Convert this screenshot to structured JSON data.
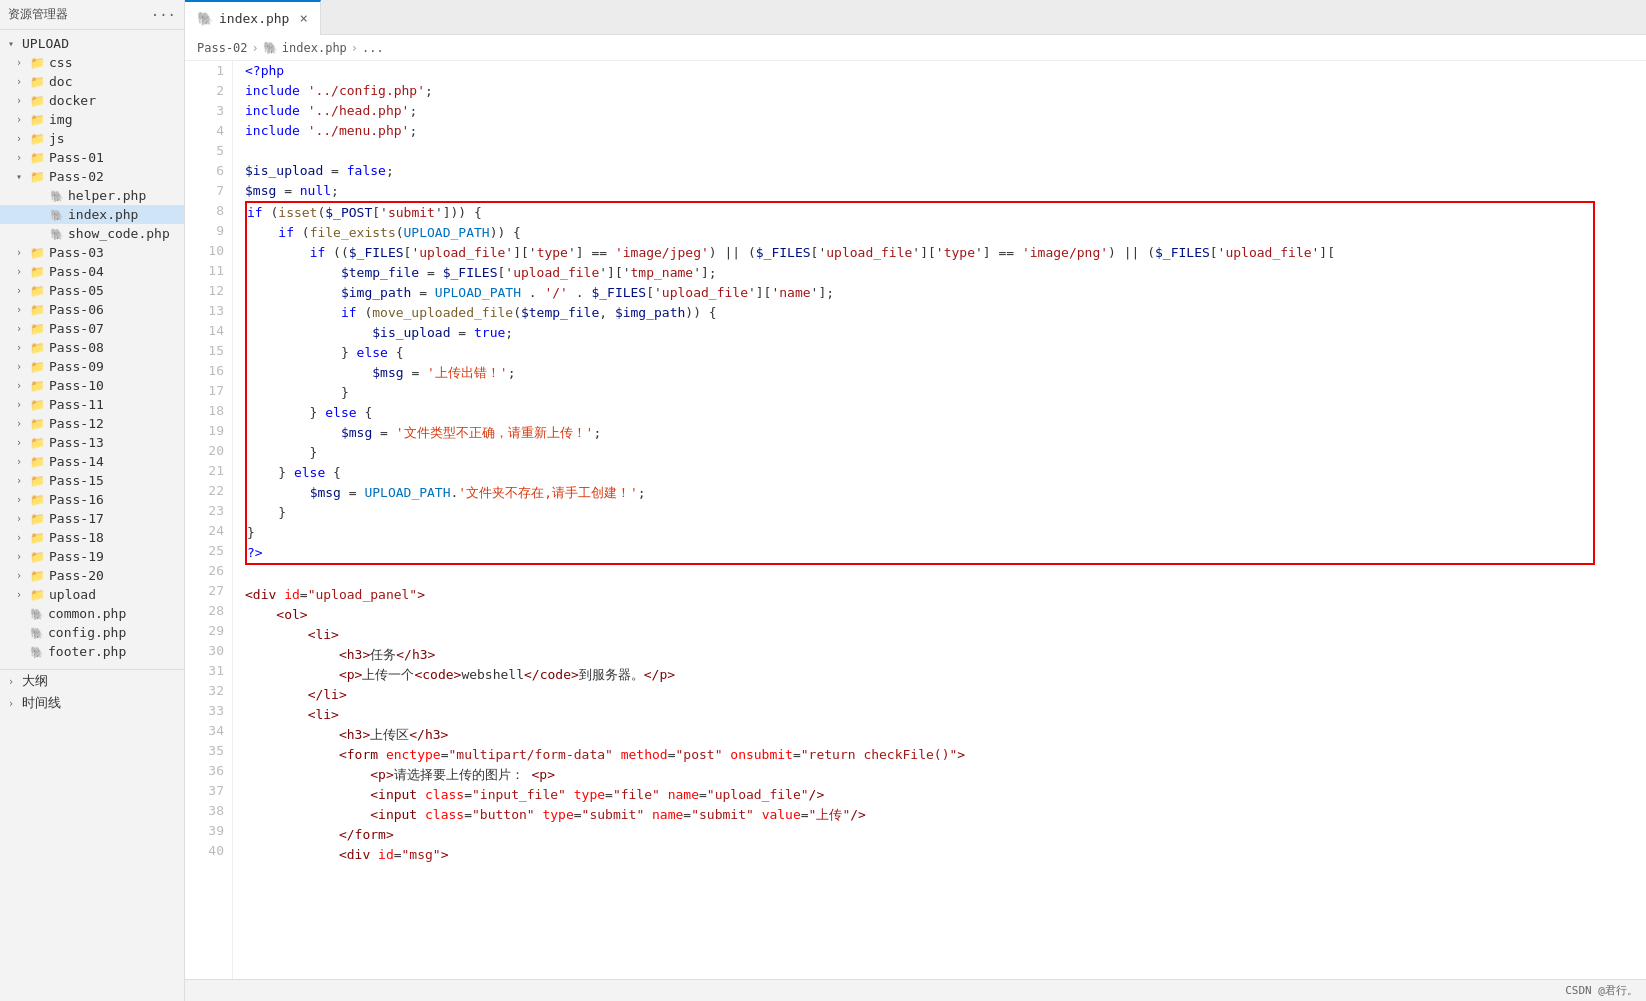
{
  "sidebar": {
    "title": "资源管理器",
    "upload_section": "UPLOAD",
    "items": [
      {
        "label": "css",
        "type": "folder",
        "level": 1,
        "expanded": false
      },
      {
        "label": "doc",
        "type": "folder",
        "level": 1,
        "expanded": false
      },
      {
        "label": "docker",
        "type": "folder",
        "level": 1,
        "expanded": false
      },
      {
        "label": "img",
        "type": "folder",
        "level": 1,
        "expanded": false
      },
      {
        "label": "js",
        "type": "folder",
        "level": 1,
        "expanded": false
      },
      {
        "label": "Pass-01",
        "type": "folder",
        "level": 1,
        "expanded": false
      },
      {
        "label": "Pass-02",
        "type": "folder",
        "level": 1,
        "expanded": true,
        "children": [
          {
            "label": "helper.php",
            "type": "file"
          },
          {
            "label": "index.php",
            "type": "file",
            "active": true
          },
          {
            "label": "show_code.php",
            "type": "file"
          }
        ]
      },
      {
        "label": "Pass-03",
        "type": "folder",
        "level": 1,
        "expanded": false
      },
      {
        "label": "Pass-04",
        "type": "folder",
        "level": 1,
        "expanded": false
      },
      {
        "label": "Pass-05",
        "type": "folder",
        "level": 1,
        "expanded": false
      },
      {
        "label": "Pass-06",
        "type": "folder",
        "level": 1,
        "expanded": false
      },
      {
        "label": "Pass-07",
        "type": "folder",
        "level": 1,
        "expanded": false
      },
      {
        "label": "Pass-08",
        "type": "folder",
        "level": 1,
        "expanded": false
      },
      {
        "label": "Pass-09",
        "type": "folder",
        "level": 1,
        "expanded": false
      },
      {
        "label": "Pass-10",
        "type": "folder",
        "level": 1,
        "expanded": false
      },
      {
        "label": "Pass-11",
        "type": "folder",
        "level": 1,
        "expanded": false
      },
      {
        "label": "Pass-12",
        "type": "folder",
        "level": 1,
        "expanded": false
      },
      {
        "label": "Pass-13",
        "type": "folder",
        "level": 1,
        "expanded": false
      },
      {
        "label": "Pass-14",
        "type": "folder",
        "level": 1,
        "expanded": false
      },
      {
        "label": "Pass-15",
        "type": "folder",
        "level": 1,
        "expanded": false
      },
      {
        "label": "Pass-16",
        "type": "folder",
        "level": 1,
        "expanded": false
      },
      {
        "label": "Pass-17",
        "type": "folder",
        "level": 1,
        "expanded": false
      },
      {
        "label": "Pass-18",
        "type": "folder",
        "level": 1,
        "expanded": false
      },
      {
        "label": "Pass-19",
        "type": "folder",
        "level": 1,
        "expanded": false
      },
      {
        "label": "Pass-20",
        "type": "folder",
        "level": 1,
        "expanded": false
      },
      {
        "label": "upload",
        "type": "folder",
        "level": 1,
        "expanded": false
      },
      {
        "label": "common.php",
        "type": "file",
        "level": 1
      },
      {
        "label": "config.php",
        "type": "file",
        "level": 1
      },
      {
        "label": "footer.php",
        "type": "file",
        "level": 1
      }
    ],
    "bottom_items": [
      "大纲",
      "时间线"
    ]
  },
  "tab": {
    "label": "index.php",
    "close": "×"
  },
  "breadcrumb": {
    "parts": [
      "Pass-02",
      ">",
      "index.php",
      ">",
      "..."
    ]
  },
  "bottom": {
    "label": "CSDN @君行。"
  }
}
